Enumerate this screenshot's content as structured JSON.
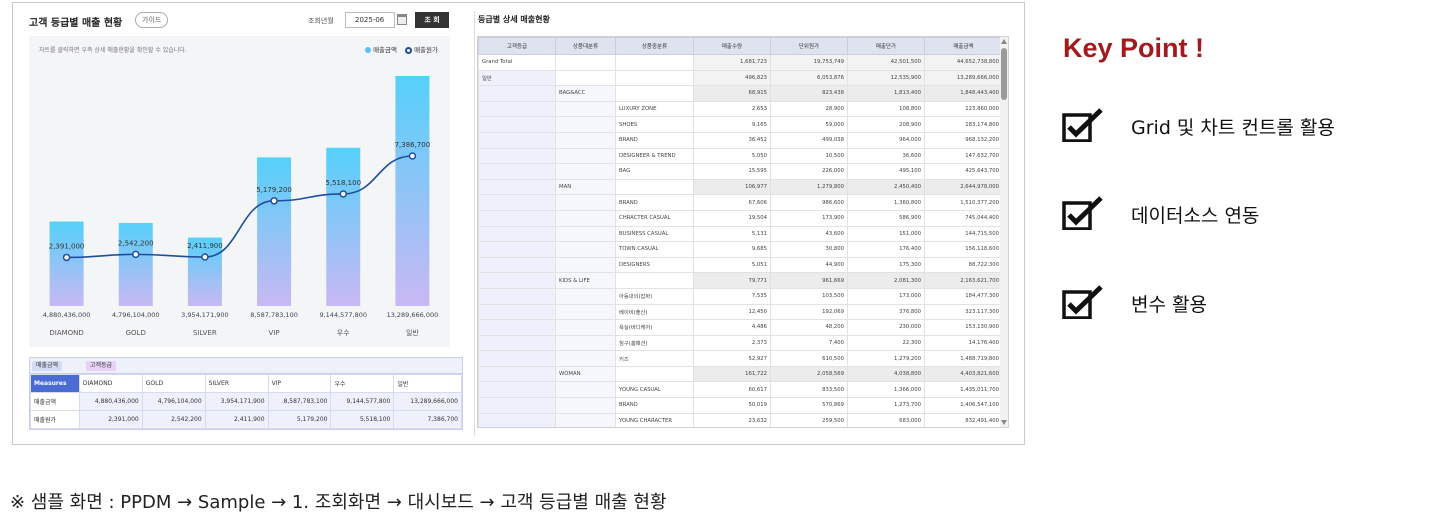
{
  "left_panel": {
    "title": "고객 등급별 매출 현황",
    "guide_button": "가이드",
    "year_month_label": "조회년월",
    "year_month_value": "2025-06",
    "query_button": "조 회",
    "chart_hint": "차트를 클릭하면 우측 상세 매출현황을 확인할 수 있습니다.",
    "legend": {
      "bar": "매출금액",
      "line": "매출원가"
    },
    "colors": {
      "bar_top": "#55d0fa",
      "bar_bottom": "#c9b8f3",
      "line": "#1e4f9c"
    }
  },
  "chart_data": {
    "type": "bar",
    "categories": [
      "DIAMOND",
      "GOLD",
      "SILVER",
      "VIP",
      "우수",
      "일반"
    ],
    "series": [
      {
        "name": "매출금액",
        "type": "bar",
        "values": [
          4880436000,
          4796104000,
          3954171900,
          8587783100,
          9144577800,
          13289666000
        ]
      },
      {
        "name": "매출원가",
        "type": "line",
        "values": [
          2391000,
          2542200,
          2411900,
          5179200,
          5518100,
          7386700
        ]
      }
    ],
    "bar_labels": [
      "4,880,436,000",
      "4,796,104,000",
      "3,954,171,900",
      "8,587,783,100",
      "9,144,577,800",
      "13,289,666,000"
    ],
    "line_labels": [
      "2,391,000",
      "2,542,200",
      "2,411,900",
      "5,179,200",
      "5,518,100",
      "7,386,700"
    ],
    "legend_position": "top-right",
    "grid": false
  },
  "pivot": {
    "chip_measure": "매출금액",
    "chip_grade": "고객등급",
    "corner": "Measures",
    "columns": [
      "DIAMOND",
      "GOLD",
      "SILVER",
      "VIP",
      "우수",
      "일반"
    ],
    "rows": [
      {
        "label": "매출금액",
        "values": [
          "4,880,436,000",
          "4,796,104,000",
          "3,954,171,900",
          "8,587,783,100",
          "9,144,577,800",
          "13,289,666,000"
        ]
      },
      {
        "label": "매출원가",
        "values": [
          "2,391,000",
          "2,542,200",
          "2,411,900",
          "5,179,200",
          "5,518,100",
          "7,386,700"
        ]
      }
    ]
  },
  "right_panel": {
    "title": "등급별 상세 매출현황",
    "columns": [
      "고객등급",
      "상품대분류",
      "상품중분류",
      "매출수량",
      "단위원가",
      "매출단가",
      "매출금액"
    ],
    "rows": [
      [
        "Grand Total",
        "",
        "",
        "1,681,723",
        "19,753,749",
        "42,501,500",
        "44,652,738,800"
      ],
      [
        "일반",
        "",
        "",
        "496,823",
        "6,053,876",
        "12,535,900",
        "13,289,666,000"
      ],
      [
        "",
        "BAG&ACC",
        "",
        "68,915",
        "823,438",
        "1,813,400",
        "1,848,443,400"
      ],
      [
        "",
        "",
        "LUXURY ZONE",
        "2,653",
        "28,900",
        "108,800",
        "123,860,000"
      ],
      [
        "",
        "",
        "SHOES",
        "9,165",
        "59,000",
        "208,900",
        "183,174,800"
      ],
      [
        "",
        "",
        "BRAND",
        "36,452",
        "499,038",
        "964,000",
        "968,132,200"
      ],
      [
        "",
        "",
        "DESIGNEER & TREND",
        "5,050",
        "10,500",
        "36,600",
        "147,632,700"
      ],
      [
        "",
        "",
        "BAG",
        "15,595",
        "226,000",
        "495,100",
        "425,643,700"
      ],
      [
        "",
        "MAN",
        "",
        "106,977",
        "1,279,800",
        "2,450,400",
        "2,644,978,000"
      ],
      [
        "",
        "",
        "BRAND",
        "67,606",
        "986,600",
        "1,360,800",
        "1,510,377,200"
      ],
      [
        "",
        "",
        "CHRACTER CASUAL",
        "19,504",
        "173,900",
        "586,900",
        "745,044,400"
      ],
      [
        "",
        "",
        "BUSINESS CASUAL",
        "5,131",
        "43,600",
        "151,000",
        "144,715,500"
      ],
      [
        "",
        "",
        "TOWN CASUAL",
        "9,685",
        "30,800",
        "176,400",
        "156,118,600"
      ],
      [
        "",
        "",
        "DESIGNERS",
        "5,051",
        "44,900",
        "175,300",
        "88,722,300"
      ],
      [
        "",
        "KIDS & LIFE",
        "",
        "79,771",
        "961,669",
        "2,081,300",
        "2,163,621,700"
      ],
      [
        "",
        "",
        "아동내의(잡화)",
        "7,535",
        "103,500",
        "173,000",
        "184,477,300"
      ],
      [
        "",
        "",
        "베이비(출산)",
        "12,450",
        "192,069",
        "376,800",
        "323,117,300"
      ],
      [
        "",
        "",
        "욕실(바디케어)",
        "4,486",
        "48,200",
        "230,000",
        "153,130,900"
      ],
      [
        "",
        "",
        "침구(홈패션)",
        "2,373",
        "7,400",
        "22,300",
        "14,176,400"
      ],
      [
        "",
        "",
        "키즈",
        "52,927",
        "610,500",
        "1,279,200",
        "1,488,719,800"
      ],
      [
        "",
        "WOMAN",
        "",
        "161,722",
        "2,058,569",
        "4,038,800",
        "4,403,821,600"
      ],
      [
        "",
        "",
        "YOUNG CASUAL",
        "60,617",
        "833,500",
        "1,366,000",
        "1,435,011,700"
      ],
      [
        "",
        "",
        "BRAND",
        "50,019",
        "570,869",
        "1,273,700",
        "1,406,547,100"
      ],
      [
        "",
        "",
        "YOUNG CHARACTER",
        "23,632",
        "259,500",
        "683,000",
        "832,491,400"
      ]
    ]
  },
  "key_point": {
    "title": "Key Point !",
    "items": [
      "Grid 및 차트 컨트롤 활용",
      "데이터소스 연동",
      "변수 활용"
    ],
    "accent_color": "#a31a1e"
  },
  "footnote": "※ 샘플 화면 : PPDM → Sample → 1. 조회화면 → 대시보드 → 고객 등급별 매출 현황"
}
